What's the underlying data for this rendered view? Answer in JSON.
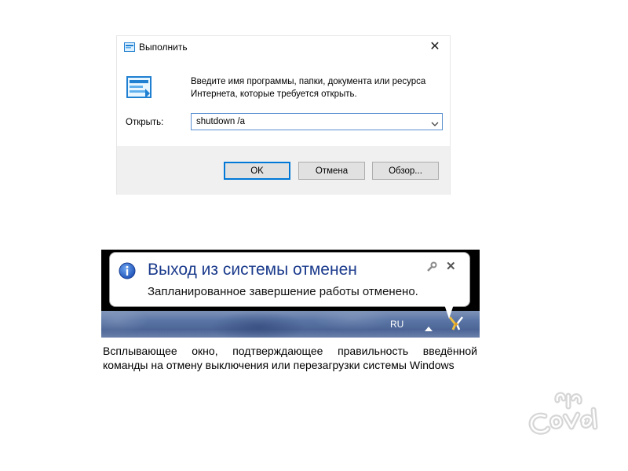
{
  "run_dialog": {
    "title": "Выполнить",
    "close_symbol": "✕",
    "description": "Введите имя программы, папки, документа или ресурса Интернета, которые требуется открыть.",
    "open_label": "Открыть:",
    "command_value": "shutdown /a",
    "buttons": {
      "ok": "OK",
      "cancel": "Отмена",
      "browse": "Обзор..."
    },
    "icon": "run-icon"
  },
  "notification": {
    "title": "Выход из системы отменен",
    "message": "Запланированное завершение работы отменено.",
    "close_symbol": "✕",
    "icons": [
      "info-icon",
      "wrench-icon",
      "close-icon"
    ]
  },
  "taskbar": {
    "language": "RU",
    "icons": [
      "tray-expand-icon",
      "tray-app-icon"
    ]
  },
  "caption": "Всплывающее окно, подтверждающее правильность введённой команды на отмену выключения или перезагрузки системы Windows",
  "colors": {
    "accent": "#0078d7",
    "balloon_title": "#1a3a8c",
    "taskbar": "#5b76a6"
  }
}
